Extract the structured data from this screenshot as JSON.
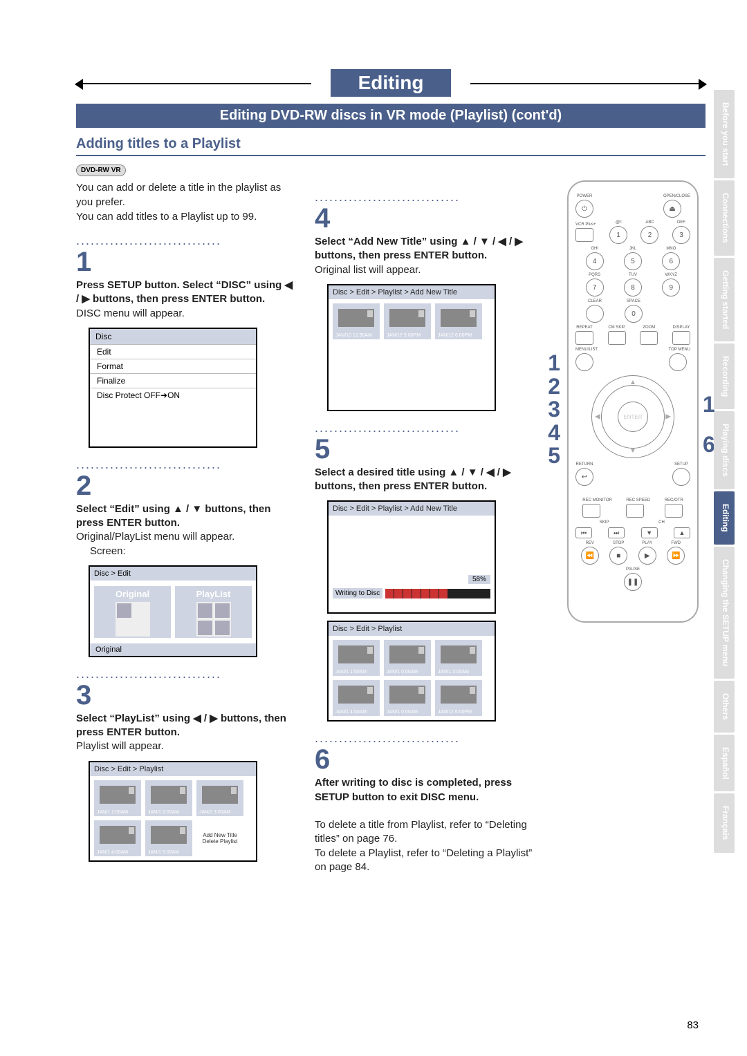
{
  "chapter_title": "Editing",
  "section_bar": "Editing DVD-RW discs in VR mode (Playlist) (cont'd)",
  "section_head": "Adding titles to a Playlist",
  "badge": "DVD-RW VR",
  "intro": "You can add or delete a title in the playlist as you prefer.\nYou can add titles to a Playlist up to 99.",
  "steps": {
    "s1": {
      "num": "1",
      "body_bold": "Press SETUP button. Select “DISC” using ◀ / ▶ buttons, then press ENTER button.",
      "body_plain": "DISC menu will appear."
    },
    "s2": {
      "num": "2",
      "body_bold": "Select “Edit” using ▲ / ▼ buttons, then press ENTER button.",
      "body_plain": "Original/PlayList menu will appear.",
      "screen_label": "Screen:"
    },
    "s3": {
      "num": "3",
      "body_bold": "Select “PlayList” using ◀ / ▶ buttons, then press ENTER button.",
      "body_plain": "Playlist will appear."
    },
    "s4": {
      "num": "4",
      "body_bold": "Select “Add New Title” using ▲ / ▼ / ◀ / ▶ buttons, then press ENTER button.",
      "body_plain": "Original list will appear."
    },
    "s5": {
      "num": "5",
      "body_bold": "Select a desired title using ▲ / ▼ / ◀ / ▶ buttons, then press ENTER button."
    },
    "s6": {
      "num": "6",
      "body_bold": "After writing to disc is completed, press SETUP button to exit DISC menu.",
      "note1": "To delete a title from Playlist, refer to “Deleting titles” on page 76.",
      "note2": "To delete a Playlist, refer to “Deleting a Playlist” on page 84."
    }
  },
  "disc_menu": {
    "header": "Disc",
    "rows": [
      "Edit",
      "Format",
      "Finalize",
      "Disc Protect OFF➜ON"
    ]
  },
  "origpl_screen": {
    "bc": "Disc > Edit",
    "tiles": [
      "Original",
      "PlayList"
    ],
    "footer": "Original"
  },
  "playlist_screen": {
    "bc": "Disc > Edit > Playlist",
    "cells": [
      "JAN/1  1:00AM",
      "JAN/1  2:00AM",
      "JAN/1  3:00AM",
      "JAN/1  4:00AM",
      "JAN/1  5:00AM"
    ],
    "textcell": [
      "Add New Title",
      "Delete Playlist"
    ]
  },
  "addnew_screen": {
    "bc": "Disc > Edit > Playlist > Add New Title",
    "cells": [
      "JAN/10 12:30AM",
      "JAN/12  5:00PM",
      "JAN/12  6:00PM"
    ]
  },
  "writing_screen": {
    "bc": "Disc > Edit > Playlist > Add New Title",
    "pct": "58%",
    "label": "Writing to Disc"
  },
  "playlist2_screen": {
    "bc": "Disc > Edit > Playlist",
    "cells": [
      "JAN/1  1:00AM",
      "JAN/1  0:00AM",
      "JAN/1  3:00AM",
      "JAN/1  4:00AM",
      "JAN/1  0:00AM",
      "JAN/12  6:00PM"
    ]
  },
  "remote": {
    "labels": {
      "power": "POWER",
      "open": "OPEN/CLOSE",
      "vcrplus": "VCR Plus+",
      "n1": ".@/:",
      "n2": "ABC",
      "n3": "DEF",
      "n4": "GHI",
      "n5": "JKL",
      "n6": "MNO",
      "n7": "PQRS",
      "n8": "TUV",
      "n9": "WXYZ",
      "clear": "CLEAR",
      "zero_space": "SPACE",
      "repeat": "REPEAT",
      "cmskip": "CM SKIP",
      "zoom": "ZOOM",
      "display": "DISPLAY",
      "menulist": "MENU/LIST",
      "topmenu": "TOP MENU",
      "enter": "ENTER",
      "return": "RETURN",
      "setup": "SETUP",
      "recmon": "REC MONITOR",
      "recspeed": "REC SPEED",
      "recotr": "REC/OTR",
      "skip": "SKIP",
      "ch": "CH",
      "stop": "STOP",
      "play": "PLAY",
      "rev": "REV",
      "fwd": "FWD",
      "pause": "PAUSE"
    },
    "callouts_left": [
      "1",
      "2",
      "3",
      "4",
      "5"
    ],
    "callouts_right": [
      "1",
      "6"
    ]
  },
  "tabs": [
    "Before you start",
    "Connections",
    "Getting started",
    "Recording",
    "Playing discs",
    "Editing",
    "Changing the SETUP menu",
    "Others",
    "Español",
    "Français"
  ],
  "active_tab": "Editing",
  "page_number": "83"
}
